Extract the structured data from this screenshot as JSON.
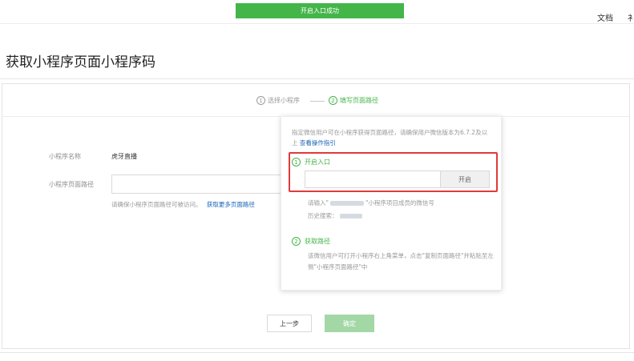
{
  "toast": {
    "text": "开启入口成功"
  },
  "top_nav": {
    "docs": "文档",
    "cut_off": "衤"
  },
  "page": {
    "title": "获取小程序页面小程序码"
  },
  "steps": [
    {
      "num": "1",
      "label": "选择小程序"
    },
    {
      "num": "2",
      "label": "填写页面路径"
    }
  ],
  "form": {
    "name_label": "小程序名称",
    "name_value": "虎牙直播",
    "path_label": "小程序页面路径",
    "path_value": "",
    "hint": "请确保小程序页面路径可被访问。",
    "hint_link": "获取更多页面路径"
  },
  "popover": {
    "intro": "指定微信用户可在小程序获得页面路径，请确保用户微信版本为6.7.2及以上",
    "intro_link": "查看操作指引",
    "section1": {
      "num": "1",
      "title": "开启入口",
      "input_value": "",
      "button": "开启",
      "note_prefix": "请输入\"",
      "note_suffix": "\"小程序项目成员的微信号",
      "history_label": "历史搜索："
    },
    "section2": {
      "num": "2",
      "title": "获取路径",
      "desc": "该微信用户可打开小程序右上角菜单，点击\"复制页面路径\"并粘贴至左侧\"小程序页面路径\"中"
    }
  },
  "actions": {
    "prev": "上一步",
    "confirm": "确定"
  },
  "colors": {
    "brand_green": "#44b549",
    "disabled_green": "#a4d7a6",
    "link_blue": "#1a63b5",
    "highlight_red": "#e03a3a"
  }
}
